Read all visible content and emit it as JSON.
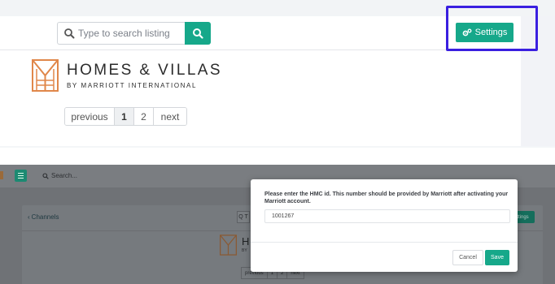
{
  "top": {
    "search": {
      "placeholder": "Type to search listing",
      "icon": "search-icon"
    },
    "settings_button": {
      "label": "Settings",
      "icon": "gears-icon"
    },
    "logo": {
      "title": "HOMES & VILLAS",
      "subtitle": "BY MARRIOTT INTERNATIONAL"
    },
    "pagination": {
      "previous": "previous",
      "pages": [
        "1",
        "2"
      ],
      "next": "next",
      "current": "1"
    },
    "colors": {
      "accent": "#16a88a",
      "highlight": "#3a1fe0",
      "logo": "#e0874a"
    }
  },
  "bottom": {
    "topbar": {
      "search_placeholder": "Search..."
    },
    "channels_link": "Channels",
    "search_small": "Q T",
    "settings_small": "ttings",
    "logo": {
      "letter": "H",
      "subtitle": "BY"
    },
    "pagination": {
      "previous": "previous",
      "pages": [
        "1",
        "2"
      ],
      "next": "next"
    },
    "modal": {
      "instruction": "Please enter the HMC id. This number should be provided by Marriott after activating your Marriott account.",
      "input_value": "1001267",
      "cancel_label": "Cancel",
      "save_label": "Save"
    }
  }
}
